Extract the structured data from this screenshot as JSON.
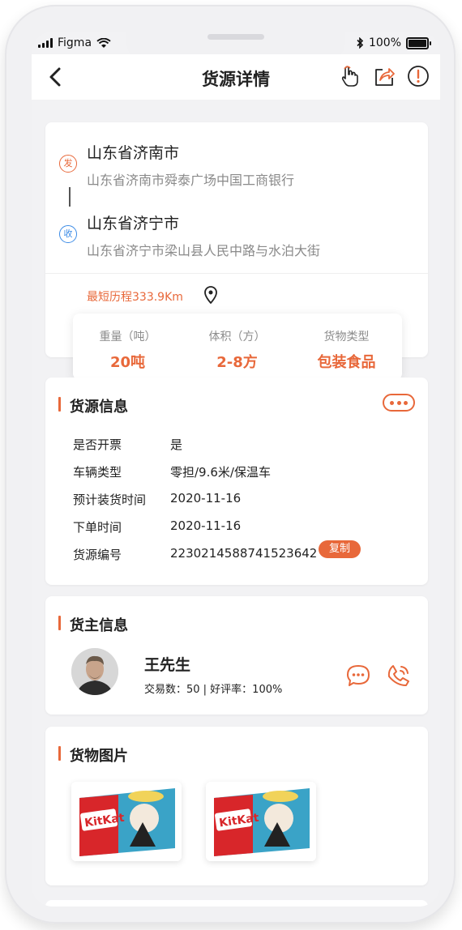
{
  "status_bar": {
    "carrier": "Figma",
    "battery_text": "100%"
  },
  "nav": {
    "title": "货源详情"
  },
  "route": {
    "origin": {
      "tag": "发",
      "city": "山东省济南市",
      "address": "山东省济南市舜泰广场中国工商银行"
    },
    "destination": {
      "tag": "收",
      "city": "山东省济宁市",
      "address": "山东省济宁市梁山县人民中路与水泊大街"
    },
    "distance": "最短历程333.9Km"
  },
  "stats": [
    {
      "label": "重量（吨）",
      "value": "20吨"
    },
    {
      "label": "体积（方）",
      "value": "2-8方"
    },
    {
      "label": "货物类型",
      "value": "包装食品"
    }
  ],
  "cargo_info": {
    "title": "货源信息",
    "rows": [
      {
        "key": "是否开票",
        "value": "是"
      },
      {
        "key": "车辆类型",
        "value": "零担/9.6米/保温车"
      },
      {
        "key": "预计装货时间",
        "value": "2020-11-16"
      },
      {
        "key": "下单时间",
        "value": "2020-11-16"
      },
      {
        "key": "货源编号",
        "value": "2230214588741523642"
      }
    ],
    "copy_label": "复制"
  },
  "owner": {
    "title": "货主信息",
    "name": "王先生",
    "meta": "交易数：50  |  好评率：100%"
  },
  "photos": {
    "title": "货物图片"
  },
  "colors": {
    "accent": "#e8683a",
    "blue": "#3b8be6",
    "background": "#f2f2f4"
  },
  "icons": [
    "signal-bars-icon",
    "wifi-icon",
    "bluetooth-icon",
    "battery-icon",
    "back-arrow-icon",
    "hand-tap-icon",
    "share-icon",
    "report-icon",
    "location-pin-icon",
    "more-dots-icon",
    "chat-icon",
    "phone-icon"
  ]
}
